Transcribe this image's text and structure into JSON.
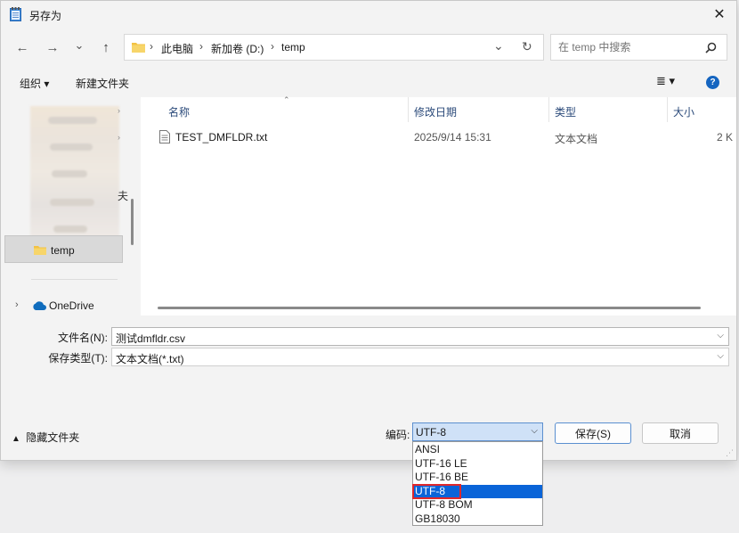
{
  "window": {
    "title": "另存为",
    "close": "✕"
  },
  "nav": {
    "back": "←",
    "forward": "→",
    "recent": "⌄",
    "up": "↑"
  },
  "address": {
    "crumbs": [
      "此电脑",
      "新加卷 (D:)",
      "temp"
    ],
    "sep": "›",
    "refresh": "↻",
    "dropdown": "⌄"
  },
  "search": {
    "placeholder": "在 temp 中搜索"
  },
  "toolbar": {
    "organize": "组织 ▾",
    "new_folder": "新建文件夹",
    "view": "≣ ▾",
    "help": "?"
  },
  "sidebar": {
    "selected": "temp",
    "onedrive": "OneDrive",
    "partial_char": "夫"
  },
  "columns": {
    "name": "名称",
    "modified": "修改日期",
    "type": "类型",
    "size": "大小"
  },
  "files": [
    {
      "name": "TEST_DMFLDR.txt",
      "modified": "2025/9/14 15:31",
      "type": "文本文档",
      "size": "2 K"
    }
  ],
  "form": {
    "filename_label": "文件名(N):",
    "filename_value": "测试dmfldr.csv",
    "filetype_label": "保存类型(T):",
    "filetype_value": "文本文档(*.txt)"
  },
  "footer": {
    "hide_folders": "隐藏文件夹",
    "encoding_label": "编码:",
    "encoding_value": "UTF-8",
    "save": "保存(S)",
    "cancel": "取消"
  },
  "encoding_options": [
    "ANSI",
    "UTF-16 LE",
    "UTF-16 BE",
    "UTF-8",
    "UTF-8 BOM",
    "GB18030"
  ],
  "encoding_selected": "UTF-8"
}
